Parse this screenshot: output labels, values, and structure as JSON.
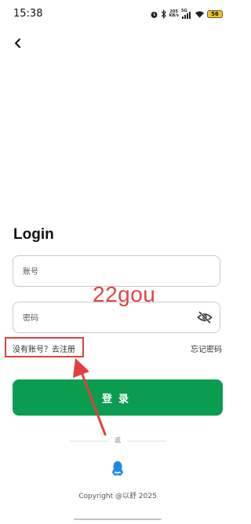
{
  "status_bar": {
    "time": "15:38",
    "network_speed_value": "205",
    "network_speed_unit": "KB/s",
    "network_type": "5G",
    "battery": "56",
    "icons": [
      "alarm-icon",
      "bluetooth-icon",
      "signal-5g-icon",
      "signal-icon",
      "wifi-icon",
      "battery-icon"
    ]
  },
  "header": {
    "back_icon": "chevron-left-icon"
  },
  "login": {
    "title": "Login",
    "account_placeholder": "账号",
    "password_placeholder": "密码",
    "toggle_visibility_icon": "eye-slash-icon",
    "register_link": "没有账号？去注册",
    "forgot_link": "忘记密码",
    "submit_label": "登录",
    "divider_text": "或",
    "qq_login_icon": "qq-penguin-icon",
    "accent_color": "#0a9c4f"
  },
  "annotation": {
    "watermark": "22gou",
    "highlight_color": "#e04040"
  },
  "footer": {
    "copyright": "Copyright @以舒 2025"
  }
}
